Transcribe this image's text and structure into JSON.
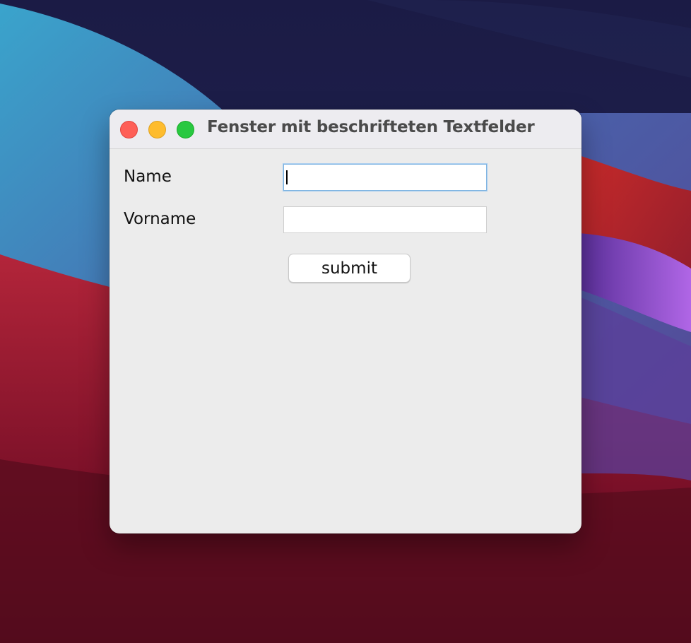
{
  "window": {
    "title": "Fenster mit beschrifteten Textfelder",
    "controls": [
      "close",
      "minimize",
      "zoom"
    ]
  },
  "form": {
    "name_label": "Name",
    "name_value": "",
    "vorname_label": "Vorname",
    "vorname_value": "",
    "submit_label": "submit"
  },
  "colors": {
    "window_bg": "#ececec",
    "titlebar_bg": "#edecf0",
    "close": "#fe5f57",
    "minimize": "#febc2e",
    "zoom": "#28c840",
    "focus_ring": "#7fb4e2"
  }
}
